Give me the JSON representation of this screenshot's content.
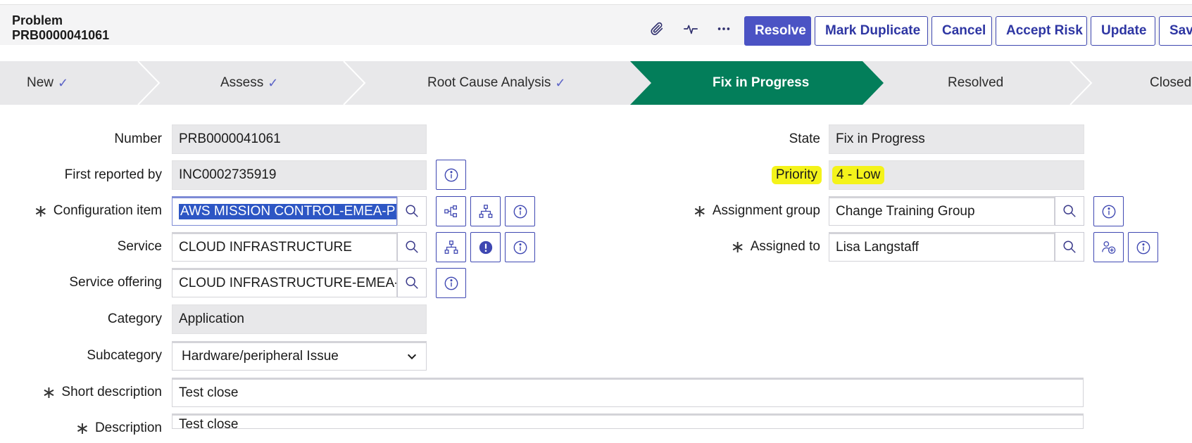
{
  "header": {
    "record_type": "Problem",
    "record_number": "PRB0000041061",
    "icons": [
      "paperclip-icon",
      "activity-icon",
      "more-icon"
    ],
    "buttons": {
      "resolve": "Resolve",
      "mark_duplicate": "Mark Duplicate",
      "cancel": "Cancel",
      "accept_risk": "Accept Risk",
      "update": "Update",
      "save": "Save"
    }
  },
  "process_flow": {
    "stages": [
      {
        "label": "New",
        "completed": true
      },
      {
        "label": "Assess",
        "completed": true
      },
      {
        "label": "Root Cause Analysis",
        "completed": true
      },
      {
        "label": "Fix in Progress",
        "active": true
      },
      {
        "label": "Resolved",
        "completed": false
      },
      {
        "label": "Closed",
        "completed": false
      }
    ],
    "check_glyph": "✓",
    "active_color": "#037e5a"
  },
  "form": {
    "number": {
      "label": "Number",
      "value": "PRB0000041061"
    },
    "first_reported_by": {
      "label": "First reported by",
      "value": "INC0002735919"
    },
    "configuration_item": {
      "label": "Configuration item",
      "value": "AWS MISSION CONTROL-EMEA-PR"
    },
    "service": {
      "label": "Service",
      "value": "CLOUD INFRASTRUCTURE"
    },
    "service_offering": {
      "label": "Service offering",
      "value": "CLOUD INFRASTRUCTURE-EMEA-I"
    },
    "category": {
      "label": "Category",
      "value": "Application"
    },
    "subcategory": {
      "label": "Subcategory",
      "value": "Hardware/peripheral Issue"
    },
    "short_description": {
      "label": "Short description",
      "value": "Test close"
    },
    "description": {
      "label": "Description",
      "value": "Test close"
    },
    "state": {
      "label": "State",
      "value": "Fix in Progress"
    },
    "priority": {
      "label": "Priority",
      "value": "4 - Low"
    },
    "assignment_group": {
      "label": "Assignment group",
      "value": "Change Training Group"
    },
    "assigned_to": {
      "label": "Assigned to",
      "value": "Lisa Langstaff"
    },
    "required_marker": "∗"
  },
  "colors": {
    "primary_button": "#4b53c4",
    "accent": "#3f48b2",
    "highlight": "#f4f31a",
    "flow_active": "#037e5a",
    "readonly_bg": "#e8e8ea"
  }
}
